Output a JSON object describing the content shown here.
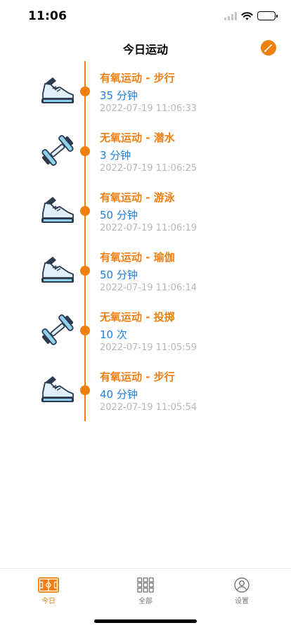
{
  "status_bar": {
    "time": "11:06"
  },
  "nav": {
    "title": "今日运动",
    "edit_icon": "pencil-icon"
  },
  "colors": {
    "accent": "#f0800e",
    "amount": "#1f7fe0",
    "timestamp": "#b7b7bb"
  },
  "entries": [
    {
      "title": "有氧运动 - 步行",
      "amount": "35 分钟",
      "time": "2022-07-19 11:06:33",
      "icon": "sneaker-icon"
    },
    {
      "title": "无氧运动 - 潜水",
      "amount": "3 分钟",
      "time": "2022-07-19 11:06:25",
      "icon": "dumbbell-icon"
    },
    {
      "title": "有氧运动 - 游泳",
      "amount": "50 分钟",
      "time": "2022-07-19 11:06:19",
      "icon": "sneaker-icon"
    },
    {
      "title": "有氧运动 - 瑜伽",
      "amount": "50 分钟",
      "time": "2022-07-19 11:06:14",
      "icon": "sneaker-icon"
    },
    {
      "title": "无氧运动 - 投掷",
      "amount": "10 次",
      "time": "2022-07-19 11:05:59",
      "icon": "dumbbell-icon"
    },
    {
      "title": "有氧运动 - 步行",
      "amount": "40 分钟",
      "time": "2022-07-19 11:05:54",
      "icon": "sneaker-icon"
    }
  ],
  "tab_bar": {
    "tabs": [
      {
        "label": "今日",
        "icon": "court-icon",
        "active": true
      },
      {
        "label": "全部",
        "icon": "grid-icon",
        "active": false
      },
      {
        "label": "设置",
        "icon": "person-circle-icon",
        "active": false
      }
    ]
  }
}
